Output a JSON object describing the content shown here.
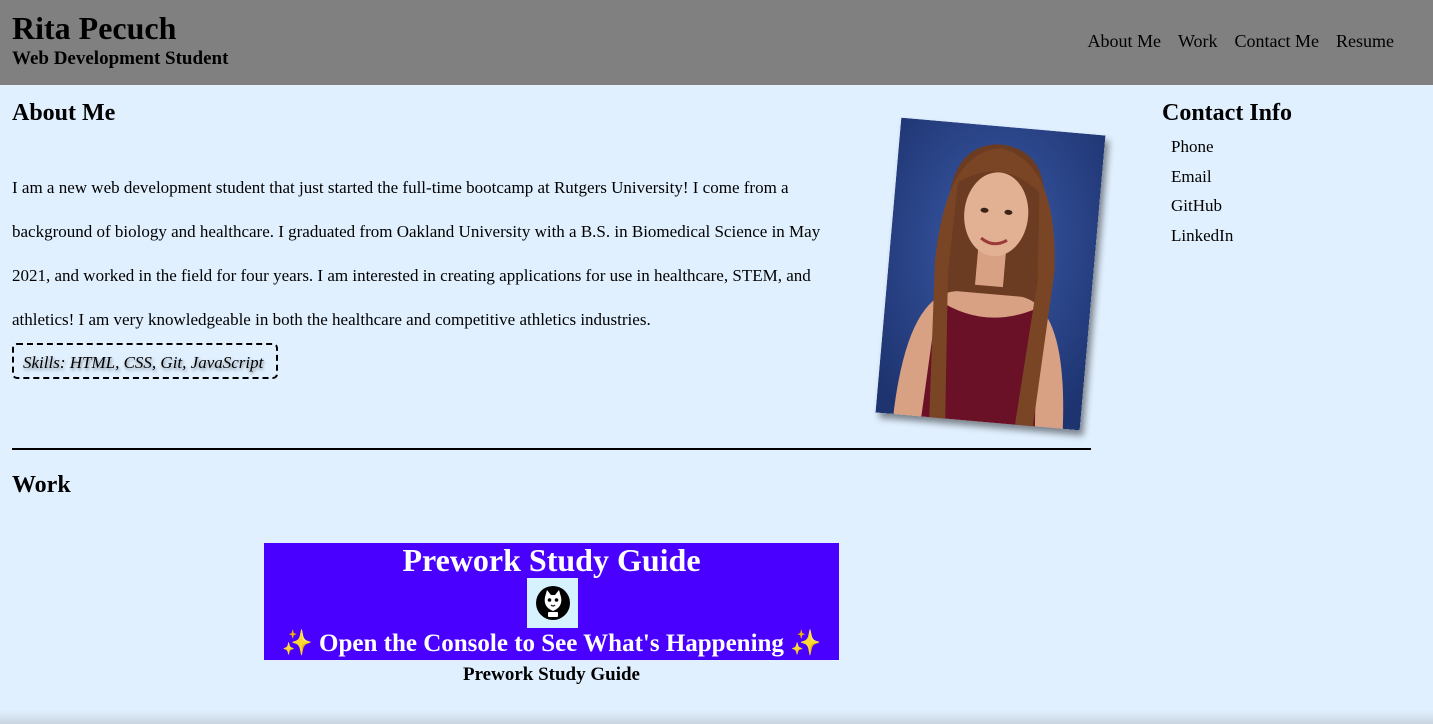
{
  "header": {
    "name": "Rita Pecuch",
    "subtitle": "Web Development Student",
    "nav": [
      "About Me",
      "Work",
      "Contact Me",
      "Resume"
    ]
  },
  "about": {
    "title": "About Me",
    "text": "I am a new web development student that just started the full-time bootcamp at Rutgers University! I come from a background of biology and healthcare. I graduated from Oakland University with a B.S. in Biomedical Science in May 2021, and worked in the field for four years. I am interested in creating applications for use in healthcare, STEM, and athletics! I am very knowledgeable in both the healthcare and competitive athletics industries.",
    "skills": "Skills: HTML, CSS, Git, JavaScript"
  },
  "work": {
    "title": "Work",
    "card_title": "Prework Study Guide",
    "card_subtitle": "✨ Open the Console to See What's Happening ✨",
    "caption": "Prework Study Guide"
  },
  "contact": {
    "title": "Contact Info",
    "items": [
      "Phone",
      "Email",
      "GitHub",
      "LinkedIn"
    ]
  },
  "colors": {
    "header_bg": "#808080",
    "page_bg": "#e1f0ff",
    "card_bg": "#4a00ff"
  }
}
